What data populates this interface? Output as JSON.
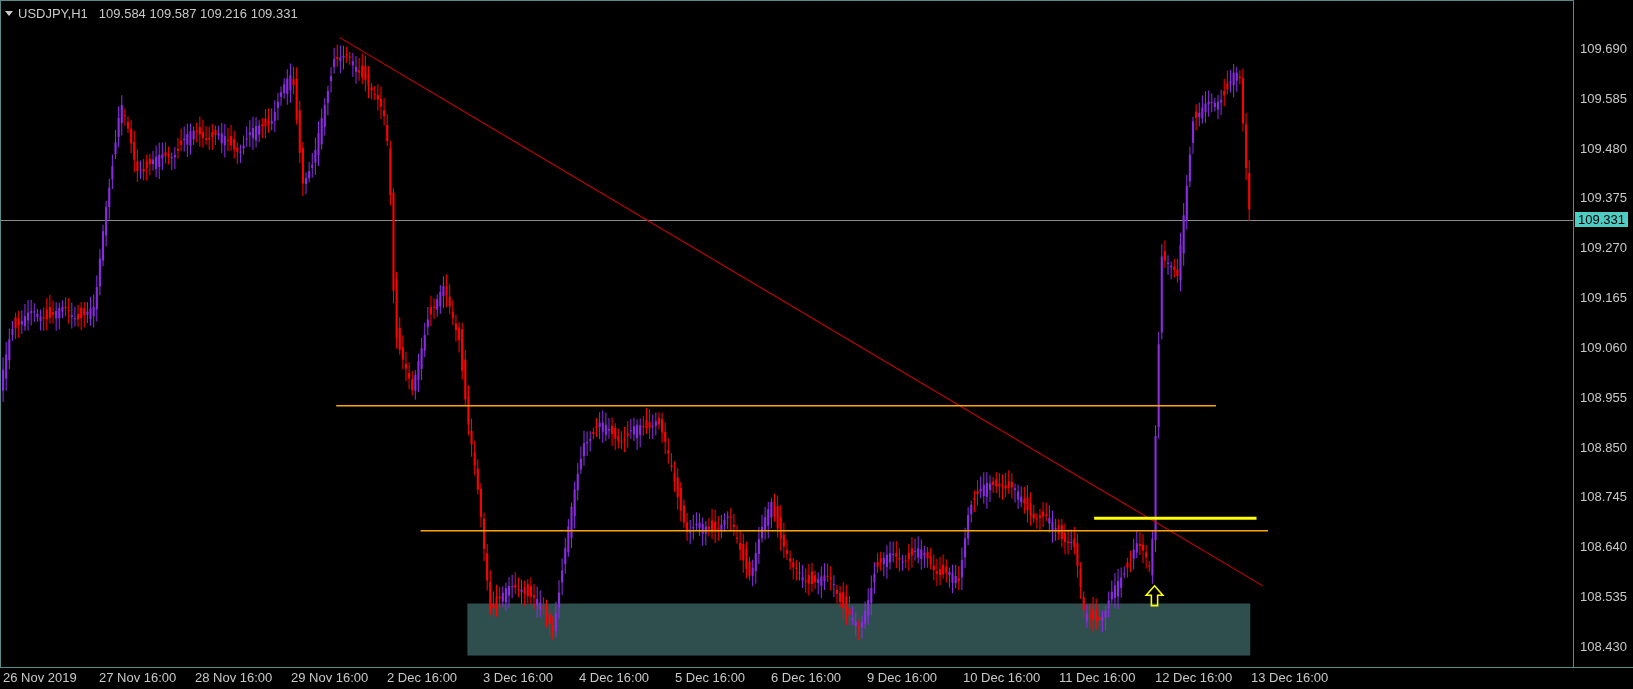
{
  "chart_header": {
    "symbol": "USDJPY,H1",
    "quote": "109.584 109.587 109.216 109.331"
  },
  "price_axis": {
    "ticks": [
      "109.690",
      "109.585",
      "109.480",
      "109.375",
      "109.270",
      "109.165",
      "109.060",
      "108.955",
      "108.850",
      "108.745",
      "108.640",
      "108.535",
      "108.430"
    ],
    "current_price": "109.331"
  },
  "time_axis": {
    "labels": [
      "26 Nov 2019",
      "27 Nov 16:00",
      "28 Nov 16:00",
      "29 Nov 16:00",
      "2 Dec 16:00",
      "3 Dec 16:00",
      "4 Dec 16:00",
      "5 Dec 16:00",
      "6 Dec 16:00",
      "9 Dec 16:00",
      "10 Dec 16:00",
      "11 Dec 16:00",
      "12 Dec 16:00",
      "13 Dec 16:00"
    ]
  }
}
